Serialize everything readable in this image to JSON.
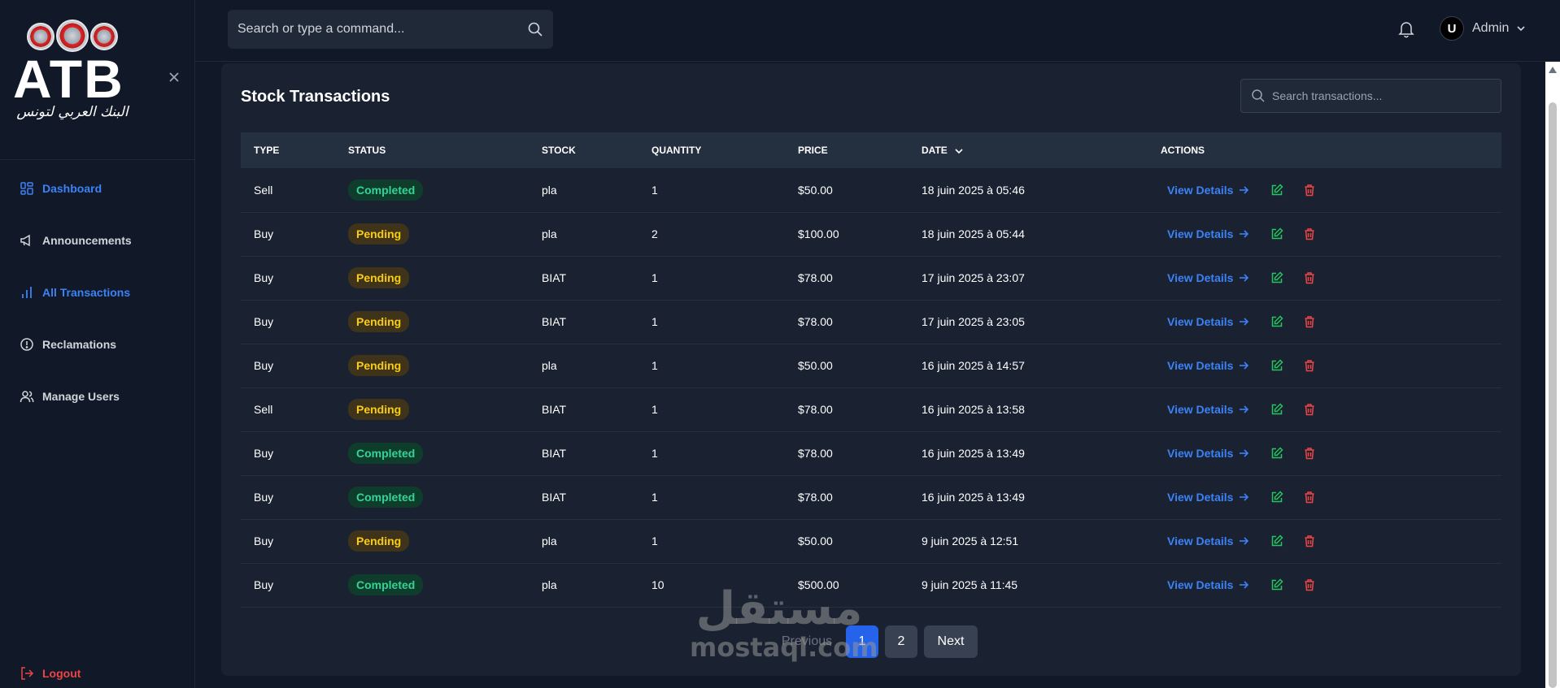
{
  "sidebar": {
    "logo": {
      "text": "ATB",
      "arabic": "البنك العربي لتونس"
    },
    "items": [
      {
        "label": "Dashboard",
        "icon": "dashboard-icon",
        "active": true
      },
      {
        "label": "Announcements",
        "icon": "megaphone-icon",
        "active": false
      },
      {
        "label": "All Transactions",
        "icon": "bar-chart-icon",
        "active": true
      },
      {
        "label": "Reclamations",
        "icon": "alert-circle-icon",
        "active": false
      },
      {
        "label": "Manage Users",
        "icon": "users-icon",
        "active": false
      }
    ],
    "logout_label": "Logout"
  },
  "topbar": {
    "search_placeholder": "Search or type a command...",
    "user_initial": "U",
    "user_name": "Admin"
  },
  "panel": {
    "title": "Stock Transactions",
    "search_placeholder": "Search transactions...",
    "columns": [
      "Type",
      "Status",
      "Stock",
      "Quantity",
      "Price",
      "Date",
      "Actions"
    ],
    "view_label": "View Details",
    "rows": [
      {
        "type": "Sell",
        "status": "Completed",
        "stock": "pla",
        "quantity": "1",
        "price": "$50.00",
        "date": "18 juin 2025 à 05:46"
      },
      {
        "type": "Buy",
        "status": "Pending",
        "stock": "pla",
        "quantity": "2",
        "price": "$100.00",
        "date": "18 juin 2025 à 05:44"
      },
      {
        "type": "Buy",
        "status": "Pending",
        "stock": "BIAT",
        "quantity": "1",
        "price": "$78.00",
        "date": "17 juin 2025 à 23:07"
      },
      {
        "type": "Buy",
        "status": "Pending",
        "stock": "BIAT",
        "quantity": "1",
        "price": "$78.00",
        "date": "17 juin 2025 à 23:05"
      },
      {
        "type": "Buy",
        "status": "Pending",
        "stock": "pla",
        "quantity": "1",
        "price": "$50.00",
        "date": "16 juin 2025 à 14:57"
      },
      {
        "type": "Sell",
        "status": "Pending",
        "stock": "BIAT",
        "quantity": "1",
        "price": "$78.00",
        "date": "16 juin 2025 à 13:58"
      },
      {
        "type": "Buy",
        "status": "Completed",
        "stock": "BIAT",
        "quantity": "1",
        "price": "$78.00",
        "date": "16 juin 2025 à 13:49"
      },
      {
        "type": "Buy",
        "status": "Completed",
        "stock": "BIAT",
        "quantity": "1",
        "price": "$78.00",
        "date": "16 juin 2025 à 13:49"
      },
      {
        "type": "Buy",
        "status": "Pending",
        "stock": "pla",
        "quantity": "1",
        "price": "$50.00",
        "date": "9 juin 2025 à 12:51"
      },
      {
        "type": "Buy",
        "status": "Completed",
        "stock": "pla",
        "quantity": "10",
        "price": "$500.00",
        "date": "9 juin 2025 à 11:45"
      }
    ],
    "pagination": {
      "previous": "Previous",
      "pages": [
        "1",
        "2"
      ],
      "current": "1",
      "next": "Next"
    }
  },
  "watermark": {
    "arabic": "مستقل",
    "latin": "mostaql.com"
  },
  "colors": {
    "accent": "#3b82f6",
    "completed": "#34d399",
    "pending": "#facc15",
    "danger": "#ef4444",
    "edit": "#22c55e"
  }
}
